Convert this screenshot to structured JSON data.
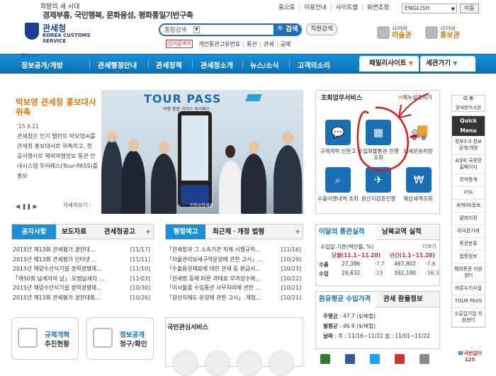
{
  "header": {
    "slogan_top": "희망의 새 시대",
    "slogan_main": "경제부흥, 국민행복, 문화융성, 평화통일기반구축",
    "logo_korean": "관세청",
    "logo_english": "KOREA CUSTOMS SERVICE",
    "util_links": [
      "홈으로",
      "이용안내",
      "사이트맵",
      "화면조정"
    ],
    "language": "ENGLISH",
    "language_go": "이동",
    "search_select": "통합검색",
    "search_button": "검색",
    "jikwon_button": "직원검색",
    "popular_tag": "인기검색어",
    "popular_keywords": [
      "개인통관고유번호",
      "통관",
      "관세",
      "공매"
    ],
    "cyber1_top": "사이버",
    "cyber1_bottom": "미술관",
    "cyber2_top": "사이버",
    "cyber2_bottom": "홍보관"
  },
  "nav": {
    "badge": "정부3.0",
    "items": [
      "정보공개/개방",
      "관세행정안내",
      "관세정책",
      "관세청소개",
      "뉴스/소식",
      "고객의소리"
    ],
    "family": "패밀리사이트",
    "customs_go": "세관가기"
  },
  "banner": {
    "title": "박보영 관세청 홍보대사 위촉",
    "date": "'15.9.21",
    "text": "관세청은 인기 탤런트 박보영씨를 관세청 홍보대사로 위촉하고, 첫 공식행사로 해외여행정보 통관 안내시스템 투어패스(Tour-PASS)를 홍보",
    "more": "자세히보기",
    "pic_title": "TOUR PASS",
    "pic_sub": "여행 통합 가이드 투어패스",
    "kiosk_label": "인천공항세관"
  },
  "services": {
    "title": "조회업무서비스",
    "settings": "메뉴설정하기",
    "items": [
      {
        "label": "규제개혁 신문고",
        "icon": "chat-icon"
      },
      {
        "label": "수입화물통관 진행조회",
        "icon": "cargo-search-icon"
      },
      {
        "label": "보세운송차량",
        "icon": "truck-icon"
      },
      {
        "label": "수출이행내역 조회",
        "icon": "magnifier-icon"
      },
      {
        "label": "원산지검증진행",
        "icon": "airplane-icon"
      },
      {
        "label": "예상세액조회",
        "icon": "won-icon"
      }
    ]
  },
  "side": {
    "dict_label": "관세용어사전",
    "quick_title": "Quick Menu",
    "quick_items": [
      "정부3.0 정보공개/개방",
      "4대악 국종망 홈페이지",
      "무역통계",
      "FTA",
      "세계HS정보",
      "팔레지정",
      "외국환거래",
      "통관분류",
      "법령정보",
      "해외통관 지원센터",
      "바른누리사업",
      "TOUR PASS",
      "수출입기업 지원센터"
    ],
    "callcenter": "국번없이 125"
  },
  "notices": {
    "tabs": [
      "공지사항",
      "보도자료",
      "관세청공고"
    ],
    "rows": [
      {
        "title": "2015년 제13회 관세평가 경진대...",
        "date": "[11/17]"
      },
      {
        "title": "2015년 제13회 관세평가 인터넷 ...",
        "date": "[11/11]"
      },
      {
        "title": "2015년 해양수산식기설 경력경쟁채...",
        "date": "[11/10]"
      },
      {
        "title": "「제50회 납세자의 날」 모범납세자 ...",
        "date": "[11/03]"
      },
      {
        "title": "2015년 해양수산식기설 경력경쟁채...",
        "date": "[10/30]"
      },
      {
        "title": "2015년 제13회 관세평가 경진대회...",
        "date": "[10/26]"
      }
    ]
  },
  "admin": {
    "tabs": [
      "행정예고",
      "최근제ㆍ개정 법령"
    ],
    "rows": [
      {
        "title": "「관세청과 그 소속기관 직제 시행규칙...",
        "date": "[11/16]"
      },
      {
        "title": "「자율관리보세구역운영에 관한 고시」...",
        "date": "[10/29]"
      },
      {
        "title": "「수출용원재료에 대한 관세 등 환급사...",
        "date": "[10/23]"
      },
      {
        "title": "「관세법 등에 따른 과태료 부과징수에...",
        "date": "[10/22]"
      },
      {
        "title": "「이사물품 수입통관 사무처리에 관한 ...",
        "date": "[10/21]"
      },
      {
        "title": "「원산지제도 운영에 관한 고시」 개정...",
        "date": "[10/21]"
      }
    ]
  },
  "stats": {
    "tab_on": "이달의 통관실적",
    "tab_off": "남북교역 실적",
    "more": "더보기",
    "unit": "수입일 기준(백만불, %)",
    "col1": "당월(11.1~11.20)",
    "col2": "년간(1.1~11.20)",
    "rows": [
      {
        "label": "수출",
        "v1": "27,386",
        "r1": "-7.7",
        "v2": "467,802",
        "r2": "-7.6"
      },
      {
        "label": "수입",
        "v1": "24,632",
        "r1": "-13",
        "v2": "392,190",
        "r2": "-16.3"
      }
    ]
  },
  "exchange": {
    "tab_on": "원유평균 수입가격",
    "tab_off": "관세 환율정보",
    "rows": [
      {
        "label": "주행금",
        "value": "47.7 ($/배럴)"
      },
      {
        "label": "월평균",
        "value": "46.9 ($/배럴)"
      },
      {
        "label": "날짜",
        "value": "주 : 11/16~11/22 월 : 11/01~11/22"
      }
    ]
  },
  "bottom": {
    "btn1_top": "규제개혁",
    "btn1_bottom": "추진현황",
    "btn2_top": "정보공개",
    "btn2_bottom": "청구/확인",
    "interest_title": "국민관심서비스"
  },
  "colors": {
    "brand_blue": "#1a90d6",
    "accent_orange": "#e07a10",
    "annotation_red": "#e01818"
  }
}
